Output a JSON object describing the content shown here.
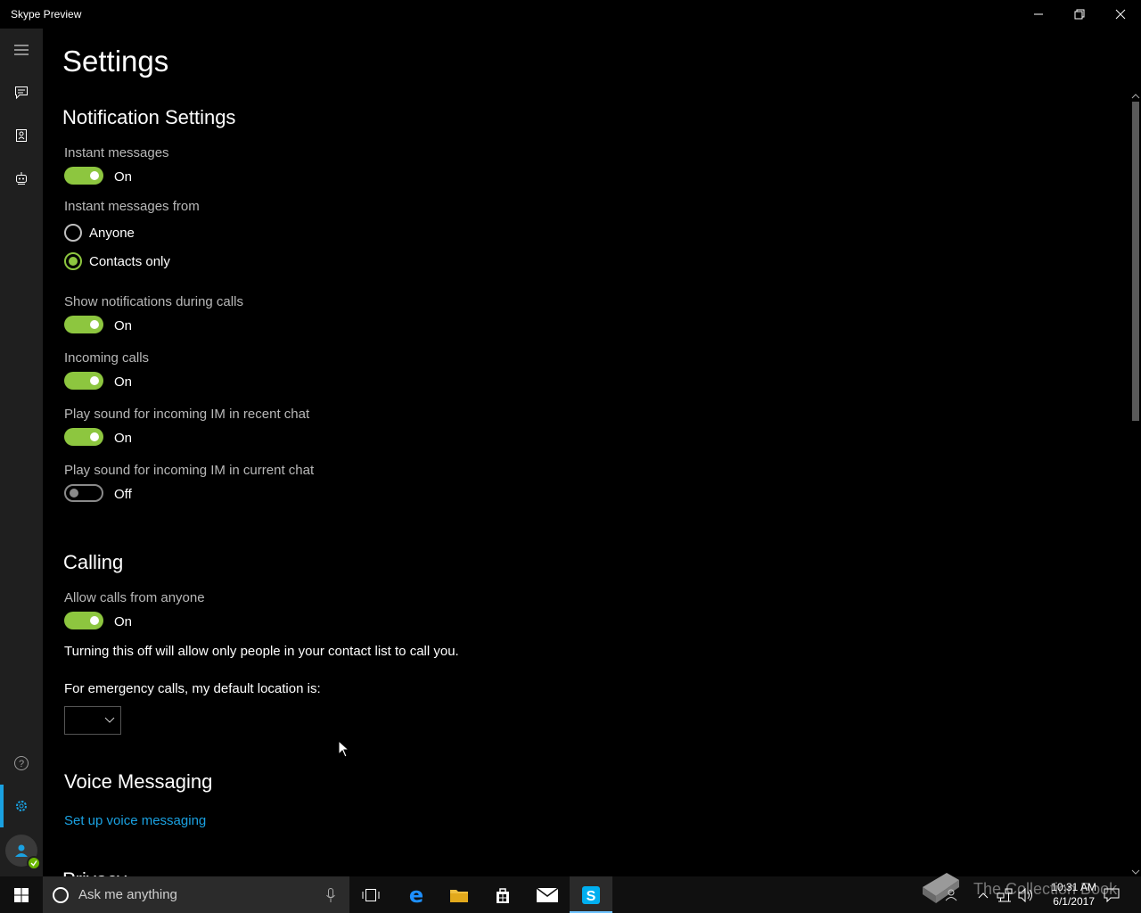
{
  "window": {
    "title": "Skype Preview"
  },
  "page": {
    "title": "Settings"
  },
  "notifications": {
    "section_title": "Notification Settings",
    "instant_messages": {
      "label": "Instant messages",
      "state": "On"
    },
    "messages_from": {
      "label": "Instant messages from",
      "options": [
        "Anyone",
        "Contacts only"
      ],
      "selected": "Contacts only"
    },
    "during_calls": {
      "label": "Show notifications during calls",
      "state": "On"
    },
    "incoming_calls": {
      "label": "Incoming calls",
      "state": "On"
    },
    "sound_recent": {
      "label": "Play sound for incoming IM in recent chat",
      "state": "On"
    },
    "sound_current": {
      "label": "Play sound for incoming IM in current chat",
      "state": "Off"
    }
  },
  "calling": {
    "section_title": "Calling",
    "allow_anyone": {
      "label": "Allow calls from anyone",
      "state": "On"
    },
    "description": "Turning this off will allow only people in your contact list to call you.",
    "emergency_label": "For emergency calls, my default location is:",
    "emergency_value": ""
  },
  "voice_messaging": {
    "section_title": "Voice Messaging",
    "setup_link": "Set up voice messaging"
  },
  "next_section_partial": "Privacy",
  "taskbar": {
    "search_placeholder": "Ask me anything",
    "time": "10:31 AM",
    "date": "6/1/2017",
    "watermark": "The Collection Book"
  },
  "colors": {
    "accent": "#1aa1e1",
    "toggle_on": "#8dc63f",
    "background": "#000000",
    "sidebar": "#1f1f1f"
  }
}
